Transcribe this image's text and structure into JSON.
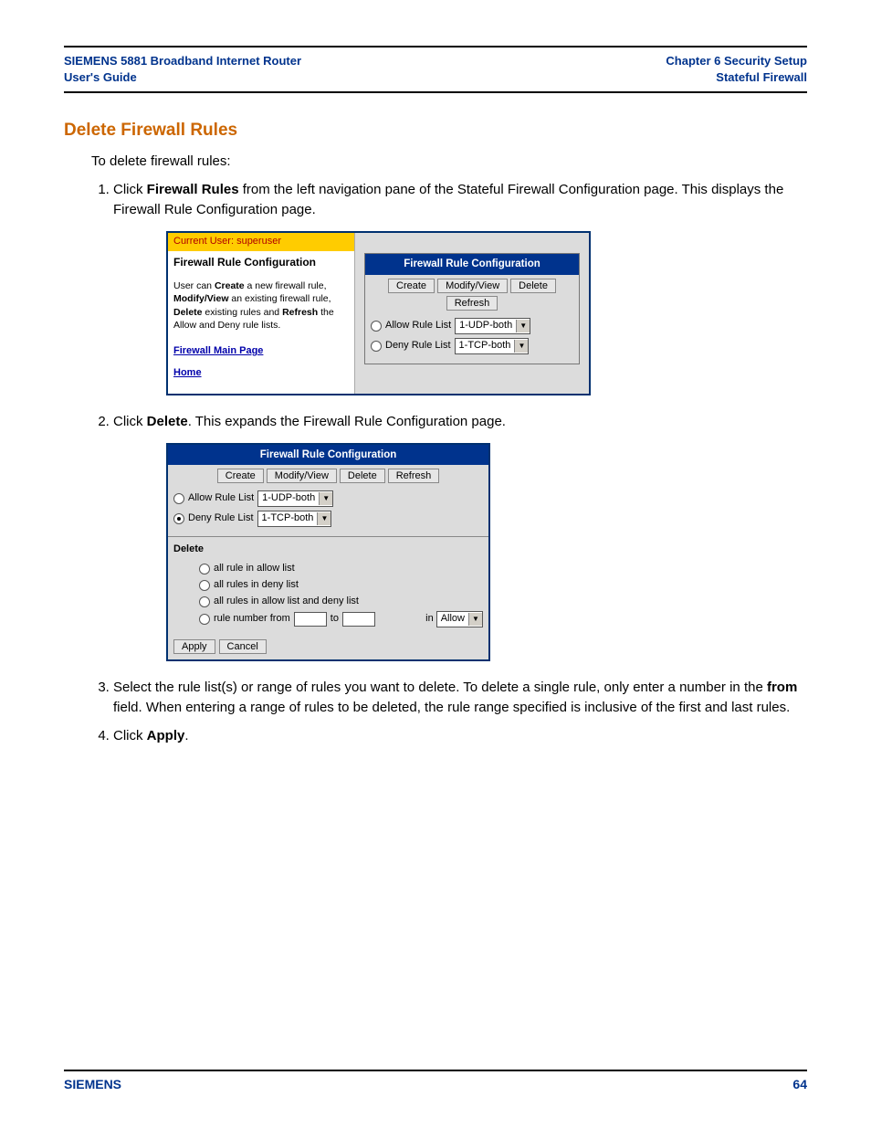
{
  "header": {
    "left_line1": "SIEMENS 5881 Broadband Internet Router",
    "left_line2": "User's Guide",
    "right_line1": "Chapter 6  Security Setup",
    "right_line2": "Stateful Firewall"
  },
  "section_title": "Delete Firewall Rules",
  "intro": "To delete firewall rules:",
  "steps": {
    "s1_pre": "Click ",
    "s1_bold": "Firewall Rules",
    "s1_post": " from the left navigation pane of the Stateful Firewall Configuration page. This displays the Firewall Rule Configuration page.",
    "s2_pre": "Click ",
    "s2_bold": "Delete",
    "s2_post": ". This expands the Firewall Rule Configuration page.",
    "s3_pre": "Select the rule list(s) or range of rules you want to delete. To delete a single rule, only enter a number in the ",
    "s3_bold": "from",
    "s3_post": " field. When entering a range of rules to be deleted, the rule range specified is inclusive of the first and last rules.",
    "s4_pre": "Click ",
    "s4_bold": "Apply",
    "s4_post": "."
  },
  "panel1": {
    "user_label": "Current User: superuser",
    "title": "Firewall Rule Configuration",
    "desc_parts": {
      "p1": "User can ",
      "b1": "Create",
      "p2": " a new firewall rule, ",
      "b2": "Modify/View",
      "p3": " an existing firewall rule, ",
      "b3": "Delete",
      "p4": " existing rules and ",
      "b4": "Refresh",
      "p5": " the Allow and Deny rule lists."
    },
    "link_main": "Firewall Main Page",
    "link_home": "Home",
    "right_header": "Firewall Rule Configuration",
    "buttons": {
      "create": "Create",
      "modify": "Modify/View",
      "delete": "Delete",
      "refresh": "Refresh"
    },
    "allow_label": "Allow Rule List",
    "allow_value": "1-UDP-both",
    "deny_label": "Deny Rule List",
    "deny_value": "1-TCP-both"
  },
  "panel2": {
    "header": "Firewall Rule Configuration",
    "buttons": {
      "create": "Create",
      "modify": "Modify/View",
      "delete": "Delete",
      "refresh": "Refresh"
    },
    "allow_label": "Allow Rule List",
    "allow_value": "1-UDP-both",
    "deny_label": "Deny Rule List",
    "deny_value": "1-TCP-both",
    "delete_title": "Delete",
    "opt1": "all rule in allow list",
    "opt2": "all rules in deny list",
    "opt3": "all rules in allow list and deny list",
    "opt4_pre": "rule number from",
    "opt4_to": "to",
    "opt4_in": "in",
    "opt4_sel": "Allow",
    "apply": "Apply",
    "cancel": "Cancel"
  },
  "footer": {
    "brand": "SIEMENS",
    "page": "64"
  }
}
